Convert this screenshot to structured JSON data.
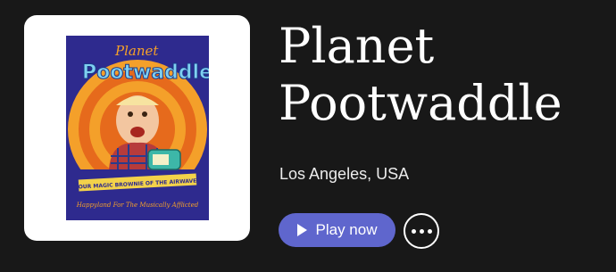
{
  "artist": {
    "name": "Planet Pootwaddle",
    "location": "Los Angeles, USA"
  },
  "artwork": {
    "logo_top": "Planet",
    "logo_main": "Pootwaddle",
    "banner": "YOUR MAGIC BROWNIE OF THE AIRWAVES",
    "tagline": "Happyland For The Musically Afflicted"
  },
  "actions": {
    "play_label": "Play now",
    "more_icon": "more-horizontal-icon",
    "play_icon": "play-icon"
  },
  "colors": {
    "background": "#181818",
    "accent": "#5f66cd"
  }
}
